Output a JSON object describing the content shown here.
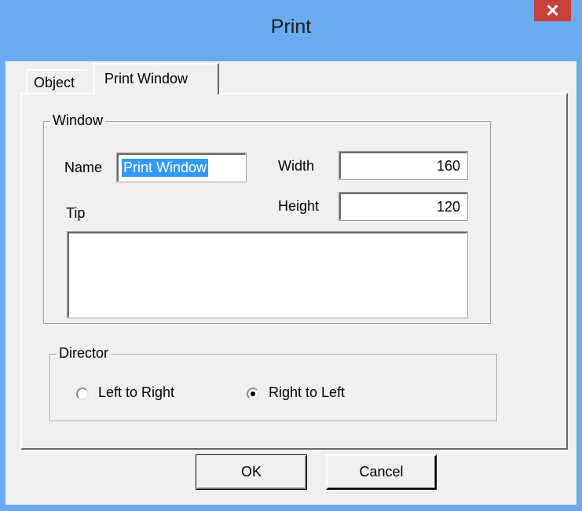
{
  "window": {
    "title": "Print",
    "close_glyph": "✕"
  },
  "tabs": [
    {
      "label": "Object",
      "selected": false
    },
    {
      "label": "Print Window",
      "selected": true
    }
  ],
  "window_group": {
    "label": "Window",
    "name_label": "Name",
    "name_value": "Print Window",
    "width_label": "Width",
    "width_value": "160",
    "height_label": "Height",
    "height_value": "120",
    "tip_label": "Tip",
    "tip_value": ""
  },
  "director_group": {
    "label": "Director",
    "options": [
      {
        "label": "Left to Right",
        "selected": false
      },
      {
        "label": "Right to Left",
        "selected": true
      }
    ]
  },
  "buttons": {
    "ok_label": "OK",
    "cancel_label": "Cancel"
  },
  "colors": {
    "titlebar": "#6aabf0",
    "close_button": "#c7413a",
    "background_app": "#e01e1e",
    "selection": "#3399ff"
  },
  "icons": {
    "close": "close-icon",
    "radio": "radio-icon"
  }
}
